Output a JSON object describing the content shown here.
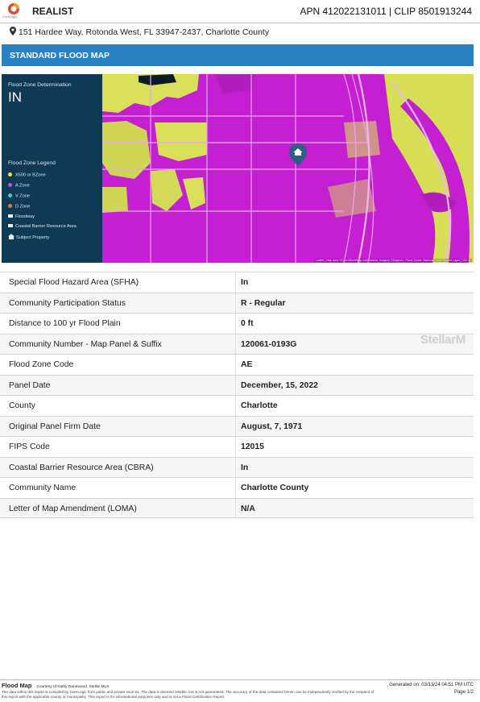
{
  "header": {
    "logo_caption": "CoreLogic",
    "brand": "REALIST",
    "apn_clip": "APN 412022131011 | CLIP 8501913244"
  },
  "address": "151 Hardee Way, Rotonda West, FL 33947-2437, Charlotte County",
  "section_title": "STANDARD FLOOD MAP",
  "map": {
    "determination_label": "Flood Zone Determination",
    "determination_value": "IN",
    "legend_title": "Flood Zone Legend",
    "legend": [
      {
        "label": "X500 or BZone",
        "color": "#f2e93b",
        "shape": "dot"
      },
      {
        "label": "A Zone",
        "color": "#c44fd6",
        "shape": "dot"
      },
      {
        "label": "V Zone",
        "color": "#3fd0e0",
        "shape": "dot"
      },
      {
        "label": "D Zone",
        "color": "#e07a2e",
        "shape": "dot"
      },
      {
        "label": "Floodway",
        "color": "#e8eef2",
        "shape": "square"
      },
      {
        "label": "Coastal Barrier Resource Area",
        "color": "#e8eef2",
        "shape": "square"
      },
      {
        "label": "Subject Property",
        "color": "#e8eef2",
        "shape": "house-icon"
      }
    ],
    "attribution": "Leaflet | Map data ©OpenStreetMap contributors, Imagery ©Mapbox | Flood Zones: National Flood Hazard Layer | 100 m",
    "colors": {
      "a_zone": "#c41fd0",
      "x500": "#d8e05a",
      "road": "#e6a6ee",
      "marker": "#2f5f86"
    }
  },
  "details": [
    {
      "label": "Special Flood Hazard Area (SFHA)",
      "value": "In"
    },
    {
      "label": "Community Participation Status",
      "value": "R - Regular"
    },
    {
      "label": "Distance to 100 yr Flood Plain",
      "value": "0 ft"
    },
    {
      "label": "Community Number - Map Panel & Suffix",
      "value": "120061-0193G"
    },
    {
      "label": "Flood Zone Code",
      "value": "AE"
    },
    {
      "label": "Panel Date",
      "value": "December, 15, 2022"
    },
    {
      "label": "County",
      "value": "Charlotte"
    },
    {
      "label": "Original Panel Firm Date",
      "value": "August, 7, 1971"
    },
    {
      "label": "FIPS Code",
      "value": "12015"
    },
    {
      "label": "Coastal Barrier Resource Area (CBRA)",
      "value": "In"
    },
    {
      "label": "Community Name",
      "value": "Charlotte County"
    },
    {
      "label": "Letter of Map Amendment (LOMA)",
      "value": "N/A"
    }
  ],
  "watermark": "StellarM",
  "footer": {
    "title": "Flood Map",
    "courtesy": "Courtesy of Kathy Danewood, Stellar MLS",
    "disclaimer": "The data within this report is compiled by CoreLogic from public and private sources. The data is deemed reliable, but is not guaranteed. The accuracy of the data contained herein can be independently verified by the recipient of this report with the applicable county or municipality. This report is for informational purposes only and is not a Flood Certification Report.",
    "generated": "Generated on: 03/13/24 04:51 PM UTC",
    "page": "Page 1/2"
  }
}
